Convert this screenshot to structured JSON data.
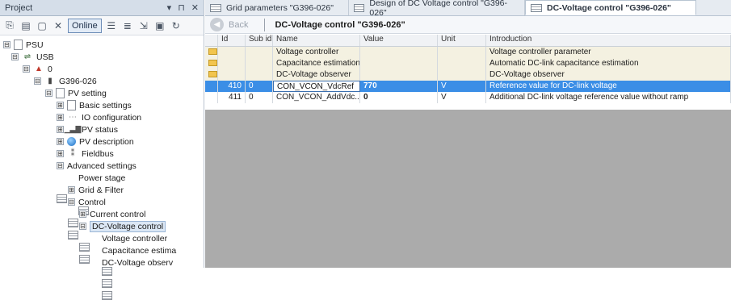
{
  "project": {
    "title": "Project",
    "title_controls": [
      "▾",
      "⊓",
      "✕"
    ],
    "toolbar": {
      "online_label": "Online"
    },
    "tree": [
      {
        "label": "PSU",
        "toggle": "⊟",
        "icon": "device"
      },
      {
        "label": "USB",
        "toggle": "⊟",
        "icon": "usb"
      },
      {
        "label": "0",
        "toggle": "⊟",
        "icon": "port"
      },
      {
        "label": "G396-026",
        "toggle": "⊟",
        "icon": "device"
      },
      {
        "label": "PV setting",
        "toggle": "⊟",
        "icon": "doc"
      },
      {
        "label": "Basic settings",
        "toggle": "⊞",
        "icon": "doc"
      },
      {
        "label": "IO configuration",
        "toggle": "⊞",
        "icon": "doc"
      },
      {
        "label": "PV status",
        "toggle": "⊞",
        "icon": "bars"
      },
      {
        "label": "PV description",
        "toggle": "⊞",
        "icon": "globe"
      },
      {
        "label": "Fieldbus",
        "toggle": "⊞",
        "icon": "doc"
      },
      {
        "label": "Advanced settings",
        "toggle": "⊟",
        "icon": "grid"
      },
      {
        "label": "Power stage",
        "toggle": "",
        "icon": "grid"
      },
      {
        "label": "Grid & Filter",
        "toggle": "⊞",
        "icon": "grid"
      },
      {
        "label": "Control",
        "toggle": "⊟",
        "icon": "grid"
      },
      {
        "label": "Current control",
        "toggle": "⊞",
        "icon": "grid"
      },
      {
        "label": "DC-Voltage control",
        "toggle": "⊟",
        "icon": "grid"
      },
      {
        "label": "Voltage controller",
        "toggle": "",
        "icon": "grid"
      },
      {
        "label": "Capacitance estima",
        "toggle": "",
        "icon": "grid"
      },
      {
        "label": "DC-Voltage observ",
        "toggle": "",
        "icon": "grid"
      }
    ]
  },
  "tabs": [
    {
      "label": "Grid parameters \"G396-026\""
    },
    {
      "label": "Design of DC Voltage control \"G396-026\""
    },
    {
      "label": "DC-Voltage control \"G396-026\""
    }
  ],
  "nav": {
    "back_label": "Back",
    "title": "DC-Voltage control \"G396-026\""
  },
  "table": {
    "headers": {
      "id": "Id",
      "sub": "Sub id",
      "name": "Name",
      "value": "Value",
      "unit": "Unit",
      "intro": "Introduction"
    },
    "rows": [
      {
        "type": "folder",
        "id": "",
        "sub": "",
        "name": "Voltage controller",
        "value": "",
        "unit": "",
        "intro": "Voltage controller parameter"
      },
      {
        "type": "folder",
        "id": "",
        "sub": "",
        "name": "Capacitance estimation",
        "value": "",
        "unit": "",
        "intro": "Automatic DC-link capacitance estimation"
      },
      {
        "type": "folder",
        "id": "",
        "sub": "",
        "name": "DC-Voltage observer",
        "value": "",
        "unit": "",
        "intro": "DC-Voltage observer"
      },
      {
        "type": "selected",
        "id": "410",
        "sub": "0",
        "name": "CON_VCON_VdcRef",
        "value": "770",
        "unit": "V",
        "intro": "Reference value for DC-link voltage"
      },
      {
        "type": "param",
        "id": "411",
        "sub": "0",
        "name": "CON_VCON_AddVdc...",
        "value": "0",
        "unit": "V",
        "intro": "Additional DC-link voltage reference value without ramp"
      }
    ]
  }
}
